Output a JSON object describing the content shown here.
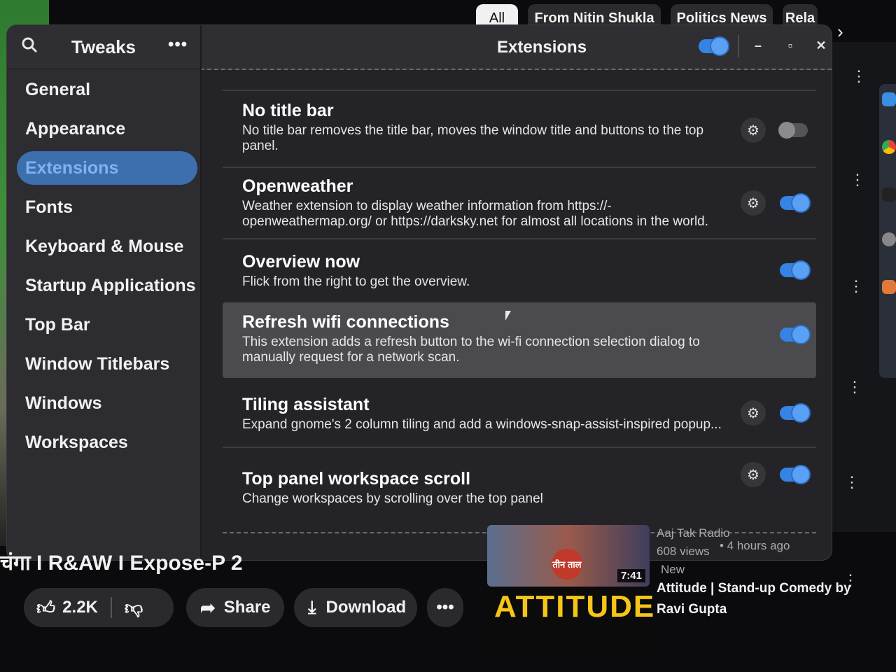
{
  "youtube": {
    "chips": [
      "All",
      "From Nitin Shukla",
      "Politics News",
      "Rela"
    ],
    "video_title": "चंगा I R&AW I Expose-P 2",
    "like_count": "2.2K",
    "share_label": "Share",
    "download_label": "Download",
    "recommendations": [
      {
        "channel": "Aaj Tak Radio",
        "views": "608 views",
        "age": "• 4 hours ago",
        "badge": "New",
        "duration": "7:41",
        "thumb_text": "तीन ताल"
      },
      {
        "title_line1": "Attitude | Stand-up Comedy by",
        "title_line2": "Ravi Gupta",
        "thumb_text": "ATTITUDE"
      }
    ]
  },
  "tweaks": {
    "app_title": "Tweaks",
    "page_title": "Extensions",
    "sidebar_items": [
      {
        "label": "General"
      },
      {
        "label": "Appearance"
      },
      {
        "label": "Extensions"
      },
      {
        "label": "Fonts"
      },
      {
        "label": "Keyboard & Mouse"
      },
      {
        "label": "Startup Applications"
      },
      {
        "label": "Top Bar"
      },
      {
        "label": "Window Titlebars"
      },
      {
        "label": "Windows"
      },
      {
        "label": "Workspaces"
      }
    ],
    "extensions": [
      {
        "title": "No title bar",
        "description": "No title bar removes the title bar, moves the window title and buttons to the top panel.",
        "has_settings": true,
        "enabled": false
      },
      {
        "title": "Openweather",
        "description": "Weather extension to display weather information from https://-openweathermap.org/ or https://darksky.net for almost all locations in the world.",
        "has_settings": true,
        "enabled": true
      },
      {
        "title": "Overview now",
        "description": "Flick from the right to get the overview.",
        "has_settings": false,
        "enabled": true
      },
      {
        "title": "Refresh wifi connections",
        "description": "This extension adds a refresh button to the wi-fi connection selection dialog to manually request for a network scan.",
        "has_settings": false,
        "enabled": true
      },
      {
        "title": "Tiling assistant",
        "description": "Expand gnome's 2 column tiling and add a windows-snap-assist-inspired popup...",
        "has_settings": true,
        "enabled": true
      },
      {
        "title": "Top panel workspace scroll",
        "description": "Change workspaces by scrolling over the top panel",
        "has_settings": true,
        "enabled": true
      }
    ],
    "global_toggle_on": true,
    "colors": {
      "accent": "#3584e4",
      "active_sidebar_bg": "#3d6fae",
      "active_sidebar_text": "#7fb2f0"
    }
  }
}
